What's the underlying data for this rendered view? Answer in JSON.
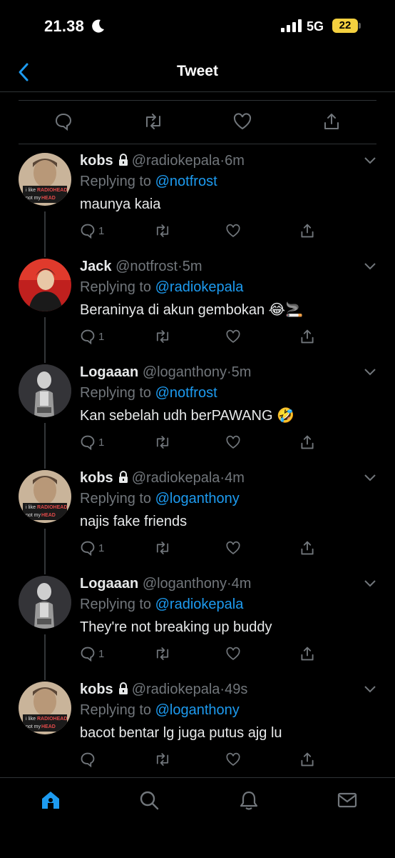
{
  "status": {
    "time": "21.38",
    "network": "5G",
    "battery": "22"
  },
  "nav": {
    "title": "Tweet"
  },
  "replies": [
    {
      "name": "kobs",
      "locked": true,
      "handle": "@radiokepala",
      "time": "6m",
      "replying_label": "Replying to",
      "replying_to": "@notfrost",
      "text": "maunya kaia",
      "reply_count": "1",
      "avatar": "radiohead-avatar"
    },
    {
      "name": "Jack",
      "locked": false,
      "handle": "@notfrost",
      "time": "5m",
      "replying_label": "Replying to",
      "replying_to": "@radiokepala",
      "text": "Beraninya di akun gembokan 😂🚬",
      "reply_count": "1",
      "avatar": "red-photo-avatar"
    },
    {
      "name": "Logaaan",
      "locked": false,
      "handle": "@loganthony",
      "time": "5m",
      "replying_label": "Replying to",
      "replying_to": "@notfrost",
      "text": "Kan sebelah udh berPAWANG 🤣",
      "reply_count": "1",
      "avatar": "mirror-selfie-avatar"
    },
    {
      "name": "kobs",
      "locked": true,
      "handle": "@radiokepala",
      "time": "4m",
      "replying_label": "Replying to",
      "replying_to": "@loganthony",
      "text": "najis fake friends",
      "reply_count": "1",
      "avatar": "radiohead-avatar"
    },
    {
      "name": "Logaaan",
      "locked": false,
      "handle": "@loganthony",
      "time": "4m",
      "replying_label": "Replying to",
      "replying_to": "@radiokepala",
      "text": "They're not breaking up buddy",
      "reply_count": "1",
      "avatar": "mirror-selfie-avatar"
    },
    {
      "name": "kobs",
      "locked": true,
      "handle": "@radiokepala",
      "time": "49s",
      "replying_label": "Replying to",
      "replying_to": "@loganthony",
      "text": "bacot bentar lg juga putus ajg lu",
      "reply_count": "",
      "avatar": "radiohead-avatar"
    }
  ],
  "avatar_text": {
    "line1": "i like",
    "line2": "RADIOHEAD",
    "line3": "not my",
    "line4": "HEAD"
  },
  "tabs": [
    "home-icon",
    "search-icon",
    "notifications-icon",
    "messages-icon"
  ],
  "colors": {
    "accent": "#1d9bf0",
    "muted": "#71767b",
    "background": "#000000",
    "battery": "#f4d03f"
  }
}
